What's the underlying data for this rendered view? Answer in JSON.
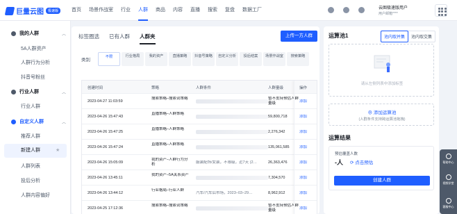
{
  "brand": {
    "name": "巨量云图",
    "badge": "极速版"
  },
  "nav": [
    "首页",
    "场景作战室",
    "行业",
    "人群",
    "商品",
    "内容",
    "直播",
    "搜索",
    "复盘",
    "数据工厂"
  ],
  "nav_active_index": 3,
  "user": {
    "name": "云图极速版用户",
    "sub": "用户邮箱****"
  },
  "sidebar": {
    "groups": [
      {
        "label": "我的人群",
        "items": [
          "5A人群资产",
          "人群行为分析",
          "抖音号粉丝"
        ]
      },
      {
        "label": "行业人群",
        "items": [
          "行业人群"
        ]
      },
      {
        "label": "自定义人群",
        "items": [
          "推荐人群",
          "新建人群",
          "人群列表",
          "投后分析",
          "人群内容偏好"
        ]
      }
    ],
    "active_item": "新建人群"
  },
  "main": {
    "tabs": [
      "标签圈选",
      "已有人群",
      "人群夹"
    ],
    "active_tab": "人群夹",
    "upload_button": "上传一方人群",
    "category_label": "类别",
    "categories": [
      "不限",
      "行业格局",
      "我的资产",
      "直播策略",
      "抖音号策略",
      "自定义分析",
      "投后结案",
      "场景作战室",
      "搜索策略"
    ],
    "table": {
      "headers": [
        "创建时间",
        "策略",
        "人群条件",
        "人群量级",
        "操作"
      ],
      "rows": [
        {
          "time": "2023-04-27 11:03:59",
          "strategy": "搜索策略–搜索词策略",
          "condition": "",
          "count": "暂不支持预估人群量级",
          "action": "添加"
        },
        {
          "time": "2023-04-26 15:47:43",
          "strategy": "直播策略–人群策略",
          "condition": "",
          "count": "59,800,718",
          "action": "添加"
        },
        {
          "time": "2023-04-26 15:47:25",
          "strategy": "直播策略–人群策略",
          "condition": "",
          "count": "2,276,342",
          "action": "添加"
        },
        {
          "time": "2023-04-26 15:47:24",
          "strategy": "直播策略–人群策略",
          "condition": "",
          "count": "135,061,585",
          "action": "添加"
        },
        {
          "time": "2023-04-26 15:05:09",
          "strategy": "我的资产–人群行为分析",
          "condition": "服装配饰/女装，不限级，近7天 (2…",
          "count": "26,363,476",
          "action": "添加"
        },
        {
          "time": "2023-04-26 13:45:11",
          "strategy": "我的资产–5A关系资产",
          "condition": "",
          "count": "7,304,570",
          "action": "添加"
        },
        {
          "time": "2023-04-26 13:44:12",
          "strategy": "行业格局–行业人群",
          "condition": "汽车/汽车后市场，2023–03–29…",
          "count": "8,962,912",
          "action": "添加"
        },
        {
          "time": "2023-04-25 17:12:36",
          "strategy": "搜索策略–搜索词策略",
          "condition": "",
          "count": "暂不支持预估人群量级",
          "action": "添加"
        }
      ]
    }
  },
  "right": {
    "title": "运算池1",
    "seg": [
      "池内取并集",
      "池内取交集"
    ],
    "seg_active_index": 0,
    "empty_text": "请从左侧列表中添加标签",
    "add_label": "添加运算池",
    "add_hint": "(人群条件支持跨运算池拖拽)",
    "result_title": "运算结果",
    "estimate_label": "预估覆盖人数",
    "estimate_value": "-人",
    "estimate_link": "点击预估",
    "create_button": "创建人群"
  },
  "float_bar": [
    "帮助中心",
    "视频学堂",
    "客服中心"
  ]
}
